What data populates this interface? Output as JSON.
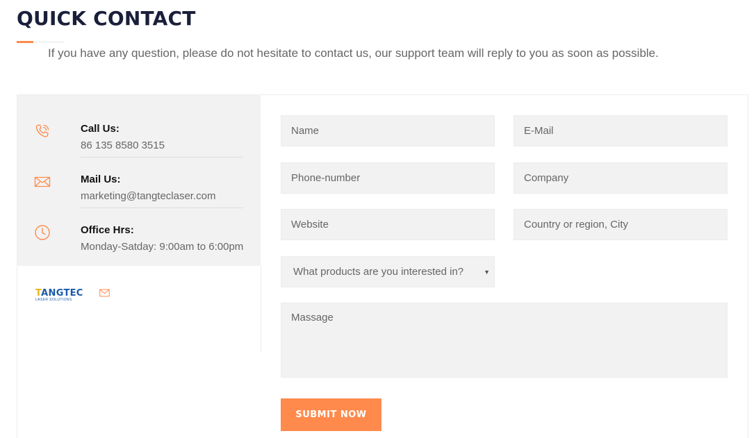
{
  "header": {
    "title": "QUICK CONTACT",
    "subtitle": "If you have any question, please do not hesitate to contact us, our support team will reply to you as soon as possible."
  },
  "contact_info": {
    "call": {
      "label": "Call Us:",
      "value": "86 135 8580 3515",
      "icon": "phone-icon"
    },
    "mail": {
      "label": "Mail Us:",
      "value": "marketing@tangteclaser.com",
      "icon": "mail-icon"
    },
    "hours": {
      "label": "Office Hrs:",
      "value": "Monday-Satday: 9:00am to 6:00pm",
      "icon": "clock-icon"
    }
  },
  "logo": {
    "brand_first": "T",
    "brand_rest": "ANGTEC",
    "tagline": "LASER SOLUTIONS"
  },
  "form": {
    "name_placeholder": "Name",
    "email_placeholder": "E-Mail",
    "phone_placeholder": "Phone-number",
    "company_placeholder": "Company",
    "website_placeholder": "Website",
    "country_placeholder": "Country or region, City",
    "product_select": "What products are you interested in?",
    "message_placeholder": "Massage",
    "submit_label": "SUBMIT NOW"
  },
  "colors": {
    "accent": "#ff8a4c",
    "panel": "#f2f2f2",
    "title": "#1a1f3a"
  }
}
